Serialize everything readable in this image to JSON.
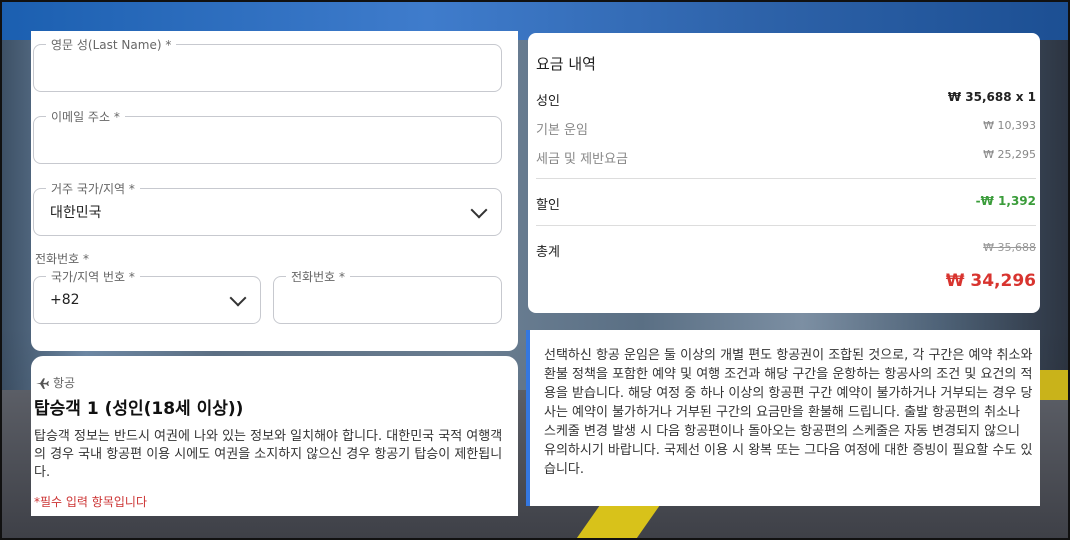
{
  "form": {
    "last_name_label": "영문 성(Last Name) *",
    "last_name_value": "",
    "email_label": "이메일 주소 *",
    "email_value": "",
    "country_label": "거주 국가/지역 *",
    "country_value": "대한민국",
    "phone_title": "전화번호 *",
    "dial_code_label": "국가/지역 번호 *",
    "dial_code_value": "+82",
    "phone_label": "전화번호 *",
    "phone_value": ""
  },
  "passenger": {
    "tag": "항공",
    "title": "탑승객 1 (성인(18세 이상))",
    "description": "탑승객 정보는 반드시 여권에 나와 있는 정보와 일치해야 합니다. 대한민국 국적 여행객의 경우 국내 항공편 이용 시에도 여권을 소지하지 않으신 경우 항공기 탑승이 제한됩니다.",
    "required_note": "*필수 입력 항목입니다"
  },
  "price": {
    "title": "요금 내역",
    "adult_label": "성인",
    "adult_value": "₩ 35,688 x 1",
    "base_fare_label": "기본 운임",
    "base_fare_value": "₩ 10,393",
    "tax_label": "세금 및 제반요금",
    "tax_value": "₩ 25,295",
    "discount_label": "할인",
    "discount_value": "-₩ 1,392",
    "total_label": "총계",
    "total_original": "₩ 35,688",
    "total_value": "₩ 34,296"
  },
  "notice": {
    "text": "선택하신 항공 운임은 둘 이상의 개별 편도 항공권이 조합된 것으로, 각 구간은 예약 취소와 환불 정책을 포함한 예약 및 여행 조건과 해당 구간을 운항하는 항공사의 조건 및 요건의 적용을 받습니다. 해당 여정 중 하나 이상의 항공편 구간 예약이 불가하거나 거부되는 경우 당사는 예약이 불가하거나 거부된 구간의 요금만을 환불해 드립니다. 출발 항공편의 취소나 스케줄 변경 발생 시 다음 항공편이나 돌아오는 항공편의 스케줄은 자동 변경되지 않으니 유의하시기 바랍니다. 국제선 이용 시 왕복 또는 그다음 여정에 대한 증빙이 필요할 수도 있습니다."
  },
  "colors": {
    "accent_blue": "#3477e0",
    "discount_green": "#3a9c3a",
    "total_red": "#d8342f",
    "required_red": "#cc3333"
  }
}
